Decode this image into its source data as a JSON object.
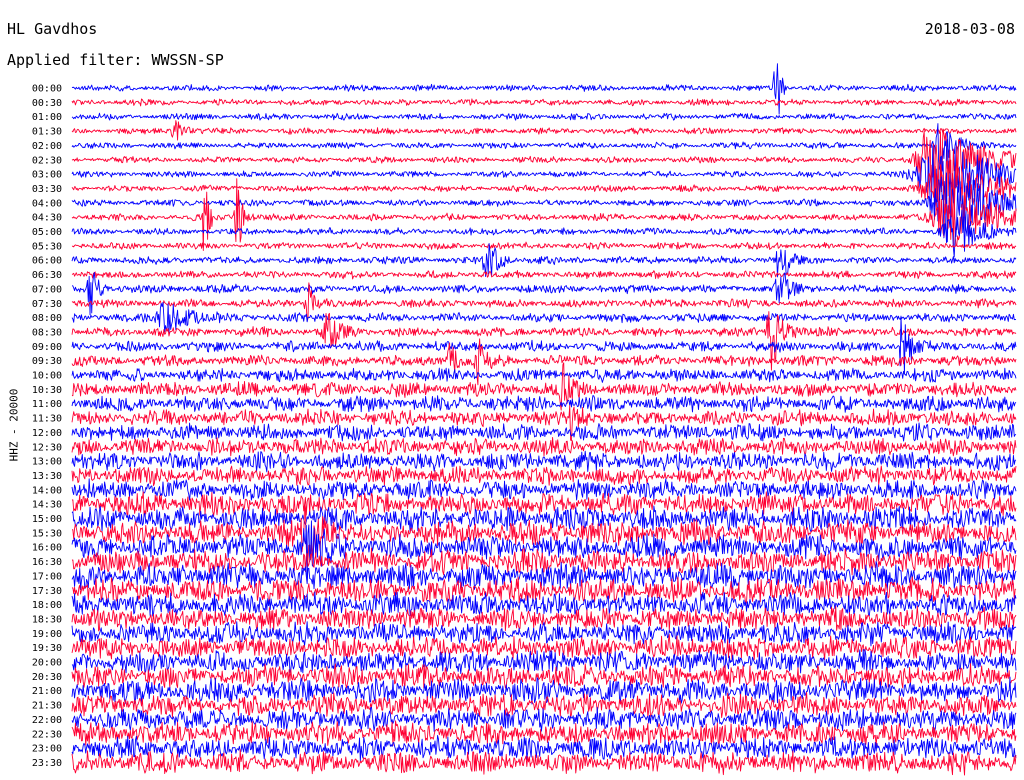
{
  "header": {
    "station": "HL Gavdhos",
    "date": "2018-03-08",
    "filter_line": "Applied filter: WWSSN-SP"
  },
  "chart_data": {
    "type": "line",
    "title": "HL Gavdhos",
    "date": "2018-03-08",
    "filter": "WWSSN-SP",
    "ylabel": "HHZ - 20000",
    "row_interval_minutes": 30,
    "colors": [
      "#0000ff",
      "#ff0033"
    ],
    "tick_labels": [
      "00:00",
      "00:30",
      "01:00",
      "01:30",
      "02:00",
      "02:30",
      "03:00",
      "03:30",
      "04:00",
      "04:30",
      "05:00",
      "05:30",
      "06:00",
      "06:30",
      "07:00",
      "07:30",
      "08:00",
      "08:30",
      "09:00",
      "09:30",
      "10:00",
      "10:30",
      "11:00",
      "11:30",
      "12:00",
      "12:30",
      "13:00",
      "13:30",
      "14:00",
      "14:30",
      "15:00",
      "15:30",
      "16:00",
      "16:30",
      "17:00",
      "17:30",
      "18:00",
      "18:30",
      "19:00",
      "19:30",
      "20:00",
      "20:30",
      "21:00",
      "21:30",
      "22:00",
      "22:30",
      "23:00",
      "23:30"
    ],
    "activity_level": [
      0.1,
      0.1,
      0.1,
      0.1,
      0.1,
      0.1,
      0.1,
      0.1,
      0.12,
      0.12,
      0.12,
      0.12,
      0.15,
      0.15,
      0.18,
      0.18,
      0.2,
      0.22,
      0.25,
      0.28,
      0.35,
      0.4,
      0.45,
      0.45,
      0.5,
      0.5,
      0.55,
      0.55,
      0.6,
      0.7,
      0.75,
      0.75,
      0.75,
      0.75,
      0.8,
      0.8,
      0.75,
      0.7,
      0.7,
      0.7,
      0.7,
      0.7,
      0.75,
      0.7,
      0.7,
      0.7,
      0.7,
      0.7
    ],
    "events": [
      {
        "row": 0,
        "t": 0.745,
        "amp": 6.0,
        "width": 0.002
      },
      {
        "row": 4,
        "t": 0.92,
        "amp": 2.0,
        "width": 0.008
      },
      {
        "row": 5,
        "t": 0.915,
        "amp": 3.0,
        "width": 0.025
      },
      {
        "row": 6,
        "t": 0.92,
        "amp": 2.6,
        "width": 0.03
      },
      {
        "row": 7,
        "t": 0.925,
        "amp": 2.2,
        "width": 0.03
      },
      {
        "row": 8,
        "t": 0.93,
        "amp": 2.6,
        "width": 0.025
      },
      {
        "row": 9,
        "t": 0.935,
        "amp": 2.2,
        "width": 0.025
      },
      {
        "row": 10,
        "t": 0.935,
        "amp": 1.8,
        "width": 0.015
      },
      {
        "row": 3,
        "t": 0.11,
        "amp": 0.7,
        "width": 0.006
      },
      {
        "row": 9,
        "t": 0.14,
        "amp": 2.8,
        "width": 0.003
      },
      {
        "row": 9,
        "t": 0.175,
        "amp": 3.2,
        "width": 0.003
      },
      {
        "row": 12,
        "t": 0.44,
        "amp": 1.8,
        "width": 0.006
      },
      {
        "row": 12,
        "t": 0.75,
        "amp": 2.0,
        "width": 0.005
      },
      {
        "row": 14,
        "t": 0.02,
        "amp": 1.8,
        "width": 0.004
      },
      {
        "row": 14,
        "t": 0.75,
        "amp": 1.6,
        "width": 0.006
      },
      {
        "row": 15,
        "t": 0.25,
        "amp": 1.5,
        "width": 0.004
      },
      {
        "row": 16,
        "t": 0.1,
        "amp": 1.2,
        "width": 0.012
      },
      {
        "row": 17,
        "t": 0.74,
        "amp": 3.4,
        "width": 0.005
      },
      {
        "row": 18,
        "t": 0.88,
        "amp": 3.2,
        "width": 0.004
      },
      {
        "row": 17,
        "t": 0.27,
        "amp": 1.6,
        "width": 0.006
      },
      {
        "row": 19,
        "t": 0.4,
        "amp": 1.4,
        "width": 0.004
      },
      {
        "row": 19,
        "t": 0.43,
        "amp": 1.6,
        "width": 0.004
      },
      {
        "row": 21,
        "t": 0.52,
        "amp": 1.6,
        "width": 0.004
      },
      {
        "row": 23,
        "t": 0.53,
        "amp": 1.6,
        "width": 0.004
      },
      {
        "row": 31,
        "t": 0.25,
        "amp": 1.8,
        "width": 0.01
      },
      {
        "row": 32,
        "t": 0.25,
        "amp": 1.6,
        "width": 0.01
      }
    ]
  }
}
